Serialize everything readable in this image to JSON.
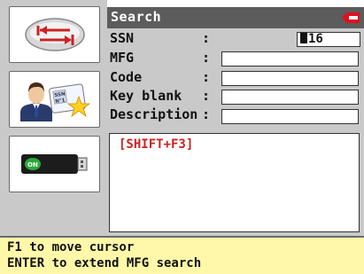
{
  "title": "Search",
  "logo": {
    "name": "brand-logo",
    "color": "#e01020"
  },
  "sidebar": {
    "buttons": [
      {
        "name": "exit-button",
        "icon": "exit-arrows-icon"
      },
      {
        "name": "ssn-search-button",
        "icon": "user-ssn-card-icon",
        "card_text_1": "SSN",
        "card_text_2": "N°1"
      },
      {
        "name": "usb-button",
        "icon": "usb-key-icon",
        "badge": "ON"
      }
    ]
  },
  "form": {
    "fields": [
      {
        "label": "SSN",
        "colon": ":",
        "value": "16"
      },
      {
        "label": "MFG",
        "colon": ":",
        "value": ""
      },
      {
        "label": "Code",
        "colon": ":",
        "value": ""
      },
      {
        "label": "Key blank",
        "colon": ":",
        "value": ""
      },
      {
        "label": "Description",
        "colon": ":",
        "value": ""
      }
    ]
  },
  "results": {
    "hint": "[SHIFT+F3]"
  },
  "footer": {
    "line1": "F1 to move cursor",
    "line2": "ENTER to extend MFG search"
  },
  "colors": {
    "titlebar": "#5c5c5c",
    "panel": "#c9c9c9",
    "footer": "#fff8a8",
    "hint": "#cc2222"
  }
}
